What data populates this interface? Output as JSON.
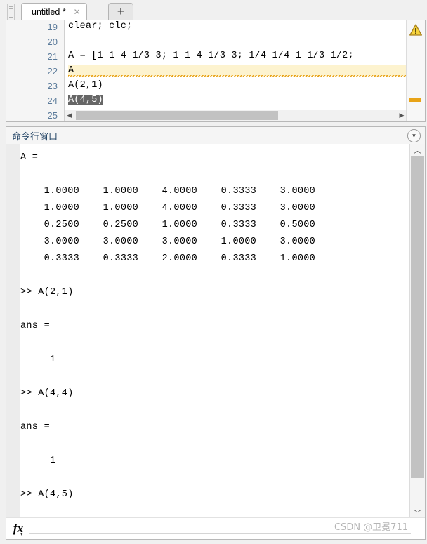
{
  "editor": {
    "tab": {
      "label": "untitled *",
      "close_icon": "✕",
      "add_icon": "+"
    },
    "line_numbers": [
      "19",
      "20",
      "21",
      "22",
      "23",
      "24",
      "25"
    ],
    "code_lines": [
      {
        "text": "clear; clc;",
        "style": "plain"
      },
      {
        "text": "",
        "style": "plain"
      },
      {
        "text": "A = [1 1 4 1/3 3; 1 1 4 1/3 3; 1/4 1/4 1 1/3 1/2; ",
        "style": "plain"
      },
      {
        "text": "A",
        "style": "warn"
      },
      {
        "text": "A(2,1)",
        "style": "plain"
      },
      {
        "text": "A(4,5)",
        "style": "selected"
      }
    ],
    "scroll": {
      "up_arrow": "▲",
      "down_arrow": "▼",
      "left_arrow": "◀",
      "right_arrow": "▶"
    },
    "markers": {
      "warning_icon": "warning-triangle",
      "warning_glyph": "!",
      "marker_color": "#e8a317"
    }
  },
  "command_window": {
    "title": "命令行窗口",
    "menu_icon": "▼",
    "scroll": {
      "up_arrow": "︿",
      "down_arrow": "﹀"
    },
    "lines": [
      "A =",
      "",
      "    1.0000    1.0000    4.0000    0.3333    3.0000",
      "    1.0000    1.0000    4.0000    0.3333    3.0000",
      "    0.2500    0.2500    1.0000    0.3333    0.5000",
      "    3.0000    3.0000    3.0000    1.0000    3.0000",
      "    0.3333    0.3333    2.0000    0.3333    1.0000",
      "",
      ">> A(2,1)",
      "",
      "ans =",
      "",
      "     1",
      "",
      ">> A(4,4)",
      "",
      "ans =",
      "",
      "     1",
      "",
      ">> A(4,5)"
    ],
    "footer": {
      "fx_label": "fx",
      "fx_caret": "▾",
      "watermark": "CSDN @卫冕711"
    }
  },
  "colors": {
    "line_number": "#5a7a9a",
    "title_text": "#2a4a6a",
    "selection_bg": "#666666",
    "warn_highlight_bg": "#fdf3cf",
    "marker_orange": "#e8a317",
    "watermark": "#b5b5b5"
  }
}
